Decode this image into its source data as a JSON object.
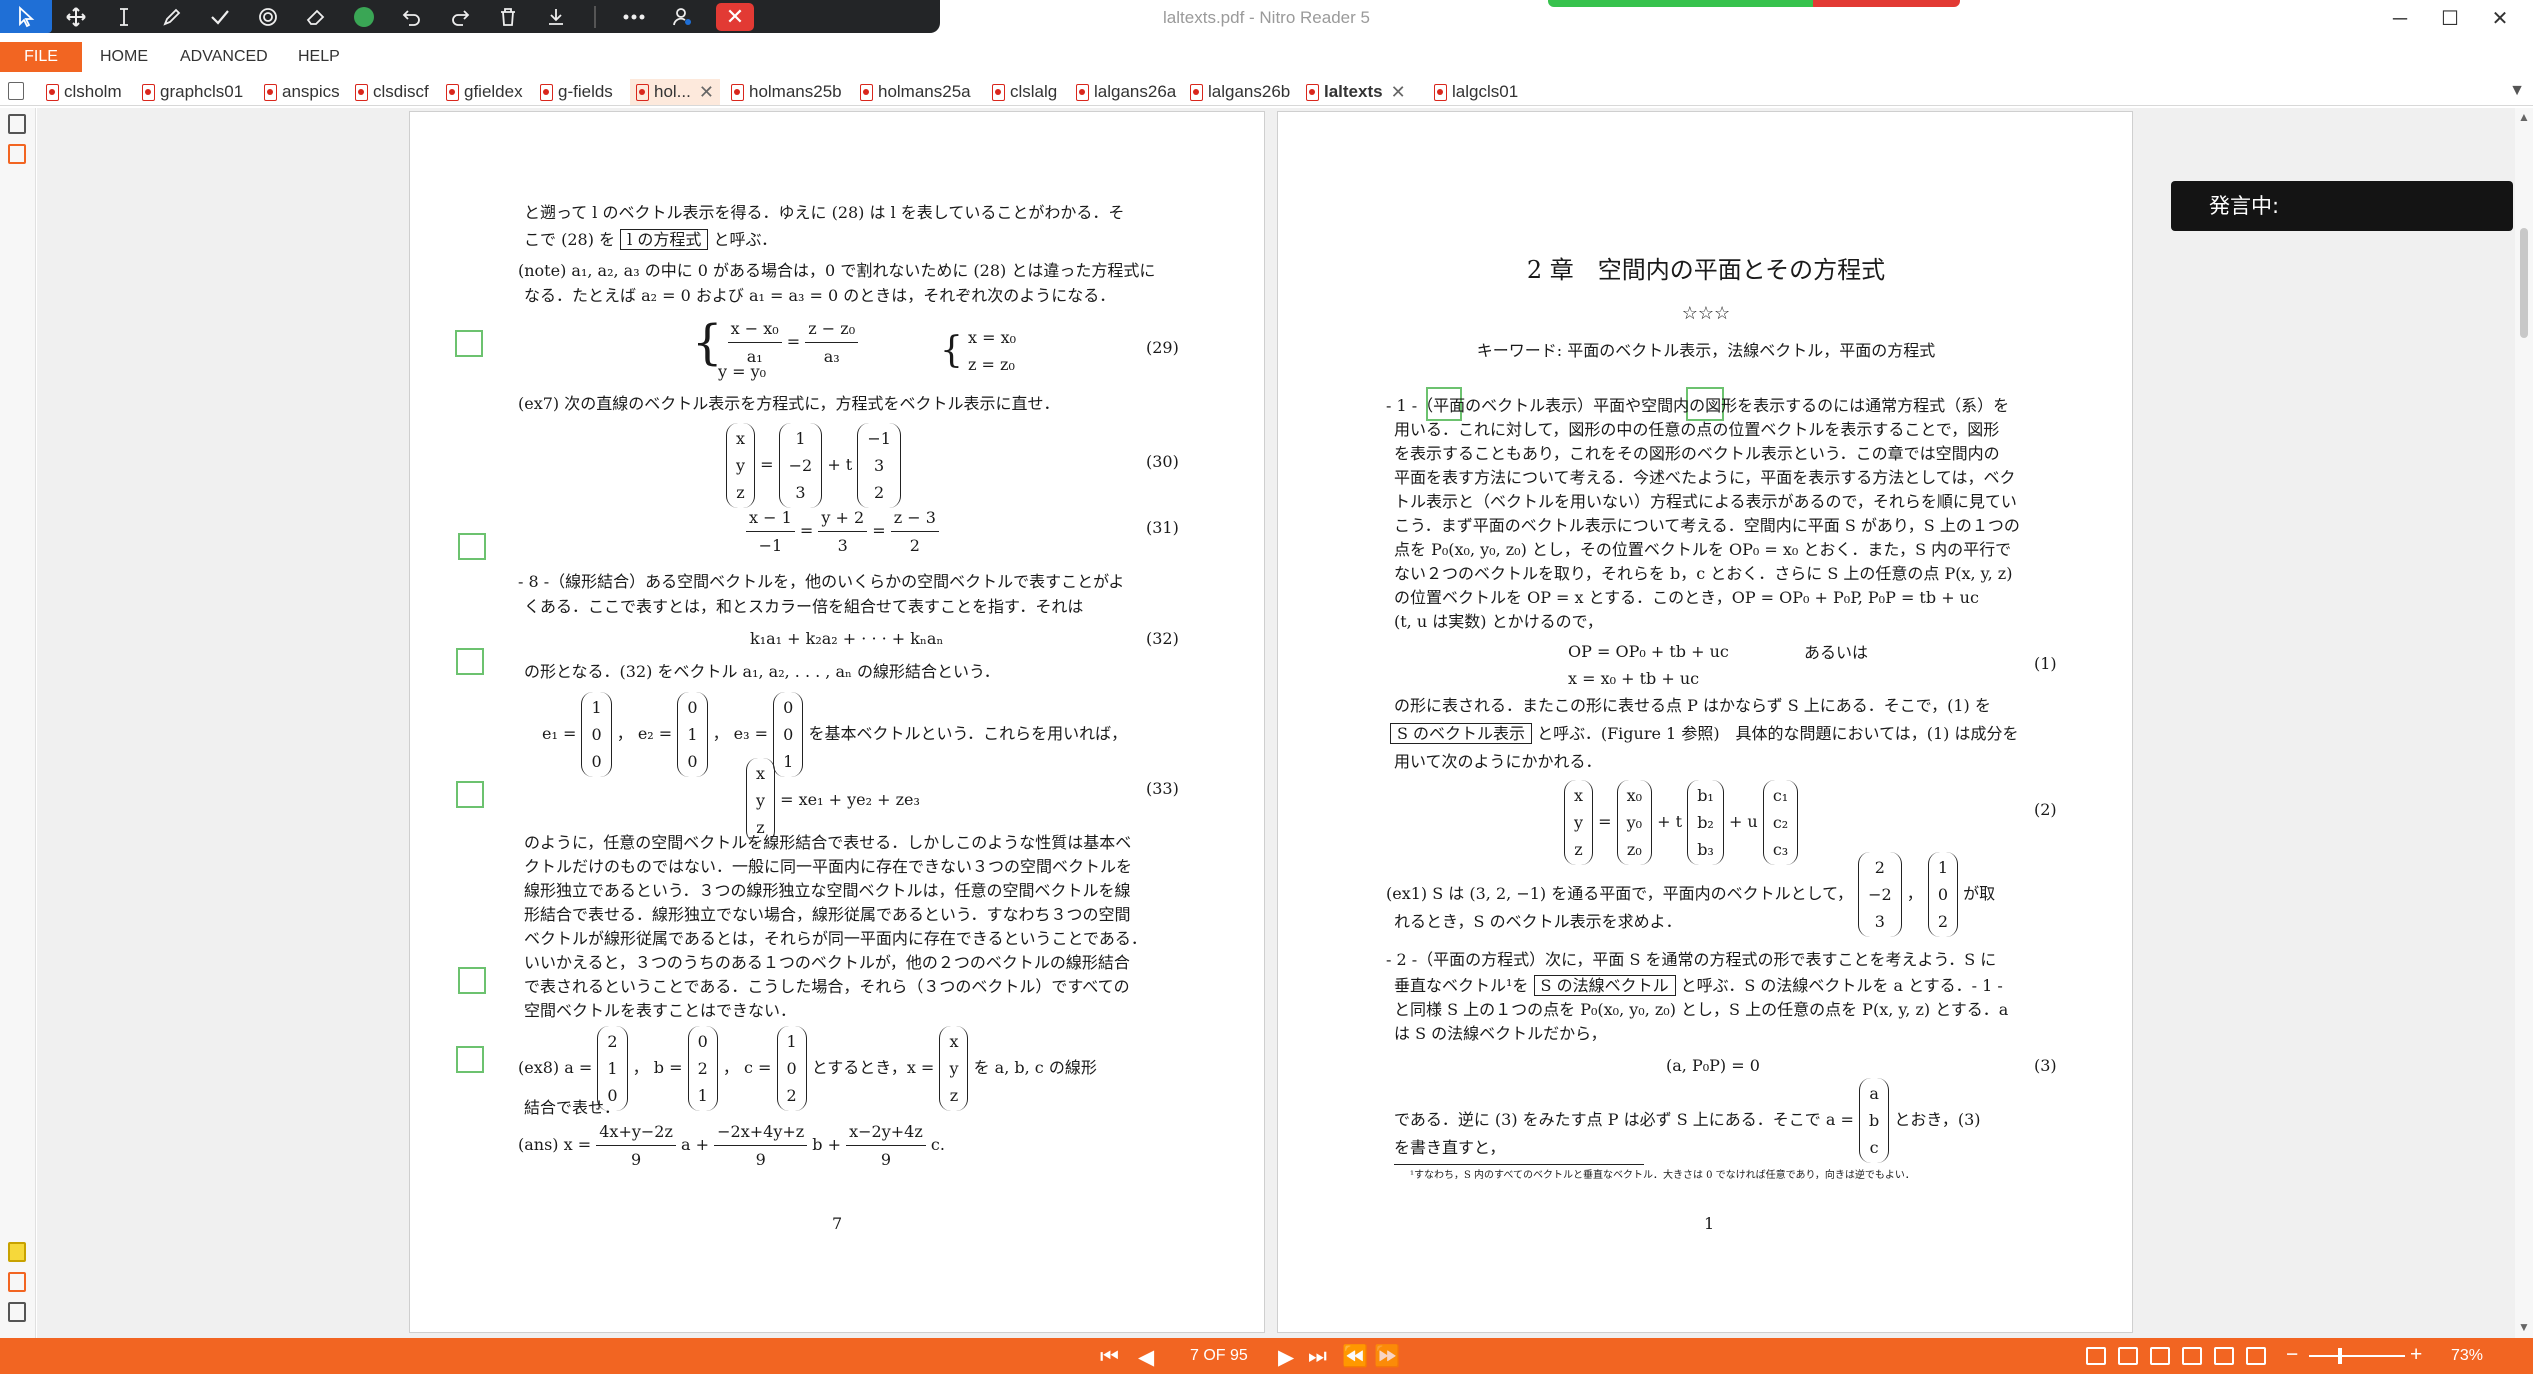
{
  "window": {
    "title": "laltexts.pdf - Nitro Reader 5",
    "minimize": "─",
    "maximize": "☐",
    "close": "✕"
  },
  "annotation_toolbar": {
    "icons": [
      "pointer-icon",
      "move-icon",
      "text-cursor-icon",
      "pen-icon",
      "check-icon",
      "stamp-icon",
      "eraser-icon",
      "color-dot-icon",
      "undo-icon",
      "redo-icon",
      "trash-icon",
      "download-icon",
      "more-icon",
      "user-settings-icon",
      "close-icon"
    ]
  },
  "menu": {
    "file": "FILE",
    "items": [
      "HOME",
      "ADVANCED",
      "HELP"
    ]
  },
  "tabs": [
    {
      "label": "clsholm"
    },
    {
      "label": "graphcls01"
    },
    {
      "label": "anspics"
    },
    {
      "label": "clsdiscf"
    },
    {
      "label": "gfieldex"
    },
    {
      "label": "g-fields"
    },
    {
      "label": "hol...",
      "selected": true,
      "close": "✕"
    },
    {
      "label": "holmans25b"
    },
    {
      "label": "holmans25a"
    },
    {
      "label": "clslalg"
    },
    {
      "label": "lalgans26a"
    },
    {
      "label": "lalgans26b"
    },
    {
      "label": "laltexts",
      "active": true,
      "close": "✕"
    },
    {
      "label": "lalgcls01"
    }
  ],
  "left_page": {
    "l1": "と遡って l のベクトル表示を得る．ゆえに (28) は l を表していることがわかる．そ",
    "l2a": "こで (28) を",
    "l2box": "l の方程式",
    "l2b": "と呼ぶ．",
    "l3": "(note) a₁, a₂, a₃ の中に 0 がある場合は，0 で割れないために (28) とは違った方程式に",
    "l4": "なる．たとえば a₂ = 0 および a₁ = a₃ = 0 のときは，それぞれ次のようになる．",
    "eq29a_num1": "x − x₀",
    "eq29a_den1": "a₁",
    "eq29a_num2": "z − z₀",
    "eq29a_den2": "a₃",
    "eq29a_line2": "y = y₀",
    "eq29b_line1": "x = x₀",
    "eq29b_line2": "z = z₀",
    "eq29": "(29)",
    "ex7": "(ex7) 次の直線のベクトル表示を方程式に，方程式をベクトル表示に直せ．",
    "eq30_v1": [
      "x",
      "y",
      "z"
    ],
    "eq30_v2": [
      "1",
      "−2",
      "3"
    ],
    "eq30_t": "+ t",
    "eq30_v3": [
      "−1",
      "3",
      "2"
    ],
    "eq30": "(30)",
    "eq31_n1": "x − 1",
    "eq31_d1": "−1",
    "eq31_n2": "y + 2",
    "eq31_d2": "3",
    "eq31_n3": "z − 3",
    "eq31_d3": "2",
    "eq31": "(31)",
    "s8a": "- 8 -（線形結合）ある空間ベクトルを，他のいくらかの空間ベクトルで表すことがよ",
    "s8b": "くある．ここで表すとは，和とスカラー倍を組合せて表すことを指す．それは",
    "eq32_expr": "k₁a₁ + k₂a₂ + · · · + kₙaₙ",
    "eq32": "(32)",
    "l32": "の形となる．(32) をベクトル a₁, a₂, . . . , aₙ の線形結合という．",
    "e1": "e₁ =",
    "e1v": [
      "1",
      "0",
      "0"
    ],
    "e2": "， e₂ =",
    "e2v": [
      "0",
      "1",
      "0"
    ],
    "e3": "， e₃ =",
    "e3v": [
      "0",
      "0",
      "1"
    ],
    "ebasis": "を基本ベクトルという．これらを用いれば，",
    "eq33_v": [
      "x",
      "y",
      "z"
    ],
    "eq33_rhs": "= xe₁ + ye₂ + ze₃",
    "eq33": "(33)",
    "p1": "のように，任意の空間ベクトルを線形結合で表せる．しかしこのような性質は基本ベ",
    "p2": "クトルだけのものではない．一般に同一平面内に存在できない３つの空間ベクトルを",
    "p3": "線形独立であるという．３つの線形独立な空間ベクトルは，任意の空間ベクトルを線",
    "p4": "形結合で表せる．線形独立でない場合，線形従属であるという．すなわち３つの空間",
    "p5": "ベクトルが線形従属であるとは，それらが同一平面内に存在できるということである．",
    "p6": "いいかえると，３つのうちのある１つのベクトルが，他の２つのベクトルの線形結合",
    "p7": "で表されるということである．こうした場合，それら（３つのベクトル）ですべての",
    "p8": "空間ベクトルを表すことはできない．",
    "ex8a": "(ex8) a =",
    "ex8av": [
      "2",
      "1",
      "0"
    ],
    "ex8b": "， b =",
    "ex8bv": [
      "0",
      "2",
      "1"
    ],
    "ex8c": "， c =",
    "ex8cv": [
      "1",
      "0",
      "2"
    ],
    "ex8d": "とするとき，x =",
    "ex8xv": [
      "x",
      "y",
      "z"
    ],
    "ex8e": "を a, b, c の線形",
    "ex8f": "結合で表せ．",
    "ans_a": "(ans) x =",
    "ans_n1": "4x+y−2z",
    "ans_d1": "9",
    "ans_b": "a +",
    "ans_n2": "−2x+4y+z",
    "ans_d2": "9",
    "ans_c": "b +",
    "ans_n3": "x−2y+4z",
    "ans_d3": "9",
    "ans_e": "c.",
    "page_number": "7"
  },
  "right_page": {
    "chapter_title": "2 章　空間内の平面とその方程式",
    "stars": "☆☆☆",
    "keywords": "キーワード: 平面のベクトル表示，法線ベクトル，平面の方程式",
    "s1a": "- 1 -（平面のベクトル表示）平面や空間内の図形を表示するのには通常方程式（系）を",
    "s1b": "用いる．これに対して，図形の中の任意の点の位置ベクトルを表示することで，図形",
    "s1c": "を表示することもあり，これをその図形のベクトル表示という．この章では空間内の",
    "s1d": "平面を表す方法について考える．今述べたように，平面を表示する方法としては，ベク",
    "s1e": "トル表示と（ベクトルを用いない）方程式による表示があるので，それらを順に見てい",
    "s1f": "こう．まず平面のベクトル表示について考える．空間内に平面 S があり，S 上の１つの",
    "s1g": "点を P₀(x₀, y₀, z₀) とし，その位置ベクトルを OP₀ = x₀ とおく．また，S 内の平行で",
    "s1h": "ない２つのベクトルを取り，それらを b，c とおく．さらに S 上の任意の点 P(x, y, z)",
    "s1i": "の位置ベクトルを OP = x とする．このとき，OP = OP₀ + P₀P, P₀P = tb + uc",
    "s1j": "(t, u は実数) とかけるので，",
    "eq1_l1": "OP  = OP₀ + tb + uc",
    "eq1_l2": "x   = x₀ + tb + uc",
    "eq1_or": "あるいは",
    "eq1": "(1)",
    "a1": "の形に表される．またこの形に表せる点 P はかならず S 上にある．そこで，(1) を",
    "a2box": "S のベクトル表示",
    "a2": "と呼ぶ．(Figure 1 参照)　具体的な問題においては，(1) は成分を",
    "a3": "用いて次のようにかかれる．",
    "eq2_v1": [
      "x",
      "y",
      "z"
    ],
    "eq2_v2": [
      "x₀",
      "y₀",
      "z₀"
    ],
    "eq2_t": "+ t",
    "eq2_v3": [
      "b₁",
      "b₂",
      "b₃"
    ],
    "eq2_u": "+ u",
    "eq2_v4": [
      "c₁",
      "c₂",
      "c₃"
    ],
    "eq2": "(2)",
    "ex1a": "(ex1) S は (3, 2, −1) を通る平面で，平面内のベクトルとして，",
    "ex1v1": [
      "2",
      "−2",
      "3"
    ],
    "ex1comma": "，",
    "ex1v2": [
      "1",
      "0",
      "2"
    ],
    "ex1b": "が取",
    "ex1c": "れるとき，S のベクトル表示を求めよ．",
    "s2a": "- 2 -（平面の方程式）次に，平面 S を通常の方程式の形で表すことを考えよう．S に",
    "s2b1": "垂直なベクトル¹を",
    "s2box": "S の法線ベクトル",
    "s2b2": "と呼ぶ．S の法線ベクトルを a とする．- 1 -",
    "s2c": "と同様 S 上の１つの点を P₀(x₀, y₀, z₀) とし，S 上の任意の点を P(x, y, z) とする．a",
    "s2d": "は S の法線ベクトルだから，",
    "eq3_expr": "(a, P₀P) = 0",
    "eq3": "(3)",
    "b1": "である．逆に (3) をみたす点 P は必ず S 上にある．そこで a =",
    "b1v": [
      "a",
      "b",
      "c"
    ],
    "b1b": "とおき，(3)",
    "b2": "を書き直すと，",
    "footnote": "¹すなわち，S 内のすべてのベクトルと垂直なベクトル．大きさは 0 でなければ任意であり，向きは逆でもよい．",
    "page_number": "1"
  },
  "overlay": {
    "speaking_label": "発言中:"
  },
  "statusbar": {
    "first": "⏮",
    "prev": "◀",
    "page_indicator": "7 OF 95",
    "next": "▶",
    "last": "⏭",
    "back": "⏪",
    "forward": "⏩",
    "zoom_minus": "−",
    "zoom_plus": "+",
    "zoom_level": "73%"
  },
  "colors": {
    "accent": "#f26522",
    "toolbar_bg": "#232527",
    "annotation_box": "#6cc26f"
  }
}
